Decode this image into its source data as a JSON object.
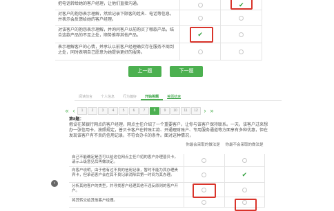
{
  "top": {
    "rows": [
      {
        "text": "把电话转给她的客户经理，让他们直接沟通。"
      },
      {
        "text": "对客户的抱怨表示理解，然后记录下顾客的姓名、电话等信息，并表示会反馈给她的客户经理。"
      },
      {
        "text": "对该客户的抱怨表示理解，并询问客户以前购买了哪款产品，结合这款产品的不足之处，顺势推荐其他产品。"
      },
      {
        "text": "表示理解客户的心情，并承认以前客户经理确实存在服务不周到之处，同时表明自己愿意为她提供更好的服务。"
      }
    ],
    "prev_label": "上一题",
    "next_label": "下一题"
  },
  "steps": {
    "items": [
      "阅读前言",
      "个人信息",
      "行为偏好",
      "开始答题",
      "答题结束"
    ]
  },
  "pager": {
    "pages": [
      "1",
      "2",
      "3",
      "4",
      "5",
      "6",
      "7",
      "8",
      "9",
      "10",
      "11",
      "12"
    ],
    "current": "8"
  },
  "question": {
    "number": "第8题：",
    "body": "假设在某银行网点的客户经理，网点主任介绍了一个重要客户，让你与该客户保持联系。一天，该客户过来想办一张信用卡，按照规定，普贝卡客户在转账汇款、开通理财账户、专用服务通道等方面享有多种优惠，但在发现该客户有不良的信用记录，不符合办卡的条件。面对这种情况，",
    "col_most": "你最会采取的做法是",
    "col_least": "你最不会采取的做法是"
  },
  "options": [
    {
      "text": "自己不能确定是否可以给这位网点主任介绍的客户办理普贝卡，请示上级意见后再做决定。"
    },
    {
      "text": "向客户说明，由于他有过不良的信用记录，暂时不能为其办理贵宾卡，但承诺客户会在其不良记录消除后第一时间为其办理。"
    },
    {
      "text": "分析其他客户的类型，并寻找客户经理其他不违反原则的客户开户。"
    },
    {
      "text": "将其转交给其他客户经理。"
    }
  ]
}
